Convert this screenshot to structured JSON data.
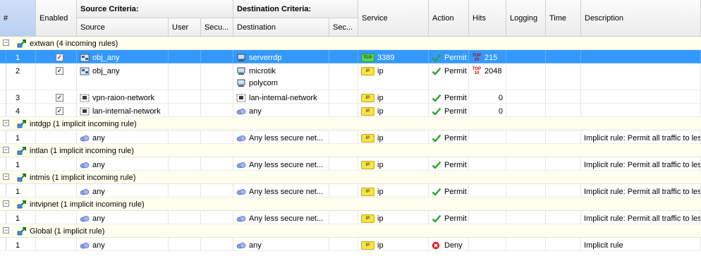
{
  "colors": {
    "selected_row": "#3399ff",
    "group_row": "#fffff0",
    "permit_green": "#2aa52a",
    "deny_red": "#d42020",
    "tcp_badge": "#5bd35b",
    "ip_badge": "#f7e34a"
  },
  "header": {
    "col_num": "#",
    "col_enabled": "Enabled",
    "source_group": "Source Criteria:",
    "dest_group": "Destination Criteria:",
    "col_source": "Source",
    "col_user": "User",
    "col_security": "Secu...",
    "col_destination": "Destination",
    "col_dest_security": "Sec...",
    "col_service": "Service",
    "col_action": "Action",
    "col_hits": "Hits",
    "col_logging": "Logging",
    "col_time": "Time",
    "col_description": "Description"
  },
  "groups": [
    {
      "label": "extwan (4 incoming rules)",
      "icon": "network-zone-icon",
      "rules": [
        {
          "num": "1",
          "enabled": true,
          "selected": true,
          "source_icon": "network-object-icon",
          "source": "obj_any",
          "destinations": [
            "serverrdp"
          ],
          "dest_icon": "server-icon",
          "service_type": "TCP",
          "service": "3389",
          "action": "Permit",
          "hits_top": true,
          "hits": "215",
          "description": ""
        },
        {
          "num": "2",
          "enabled": true,
          "selected": false,
          "source_icon": "network-object-icon",
          "source": "obj_any",
          "destinations": [
            "microtik",
            "polycom"
          ],
          "dest_icon": "server-icon",
          "service_type": "IP",
          "service": "ip",
          "action": "Permit",
          "hits_top": true,
          "hits": "2048",
          "description": ""
        },
        {
          "num": "3",
          "enabled": true,
          "selected": false,
          "source_icon": "network-grid-icon",
          "source": "vpn-raion-network",
          "destinations": [
            "lan-internal-network"
          ],
          "dest_icon": "network-grid-icon",
          "service_type": "IP",
          "service": "ip",
          "action": "Permit",
          "hits_top": false,
          "hits": "0",
          "description": ""
        },
        {
          "num": "4",
          "enabled": true,
          "selected": false,
          "source_icon": "network-grid-icon",
          "source": "lan-internal-network",
          "destinations": [
            "any"
          ],
          "dest_icon": "cloud-icon",
          "service_type": "IP",
          "service": "ip",
          "action": "Permit",
          "hits_top": false,
          "hits": "0",
          "description": ""
        }
      ]
    },
    {
      "label": "intdgp (1 implicit incoming rule)",
      "icon": "network-zone-icon",
      "rules": [
        {
          "num": "1",
          "enabled": null,
          "selected": false,
          "source_icon": "cloud-icon",
          "source": "any",
          "destinations": [
            "Any less secure net..."
          ],
          "dest_icon": "cloud-icon",
          "service_type": "IP",
          "service": "ip",
          "action": "Permit",
          "hits_top": false,
          "hits": "",
          "description": "Implicit rule: Permit all traffic to less"
        }
      ]
    },
    {
      "label": "intlan (1 implicit incoming rule)",
      "icon": "network-zone-icon",
      "rules": [
        {
          "num": "1",
          "enabled": null,
          "selected": false,
          "source_icon": "cloud-icon",
          "source": "any",
          "destinations": [
            "Any less secure net..."
          ],
          "dest_icon": "cloud-icon",
          "service_type": "IP",
          "service": "ip",
          "action": "Permit",
          "hits_top": false,
          "hits": "",
          "description": "Implicit rule: Permit all traffic to less"
        }
      ]
    },
    {
      "label": "intmis (1 implicit incoming rule)",
      "icon": "network-zone-icon",
      "rules": [
        {
          "num": "1",
          "enabled": null,
          "selected": false,
          "source_icon": "cloud-icon",
          "source": "any",
          "destinations": [
            "Any less secure net..."
          ],
          "dest_icon": "cloud-icon",
          "service_type": "IP",
          "service": "ip",
          "action": "Permit",
          "hits_top": false,
          "hits": "",
          "description": "Implicit rule: Permit all traffic to less"
        }
      ]
    },
    {
      "label": "intvipnet (1 implicit incoming rule)",
      "icon": "network-zone-icon",
      "rules": [
        {
          "num": "1",
          "enabled": null,
          "selected": false,
          "source_icon": "cloud-icon",
          "source": "any",
          "destinations": [
            "Any less secure net..."
          ],
          "dest_icon": "cloud-icon",
          "service_type": "IP",
          "service": "ip",
          "action": "Permit",
          "hits_top": false,
          "hits": "",
          "description": "Implicit rule: Permit all traffic to less"
        }
      ]
    },
    {
      "label": "Global (1 implicit rule)",
      "icon": "network-zone-icon",
      "rules": [
        {
          "num": "1",
          "enabled": null,
          "selected": false,
          "source_icon": "cloud-icon",
          "source": "any",
          "destinations": [
            "any"
          ],
          "dest_icon": "cloud-icon",
          "service_type": "IP",
          "service": "ip",
          "action": "Deny",
          "hits_top": false,
          "hits": "",
          "description": "Implicit rule"
        }
      ]
    }
  ]
}
